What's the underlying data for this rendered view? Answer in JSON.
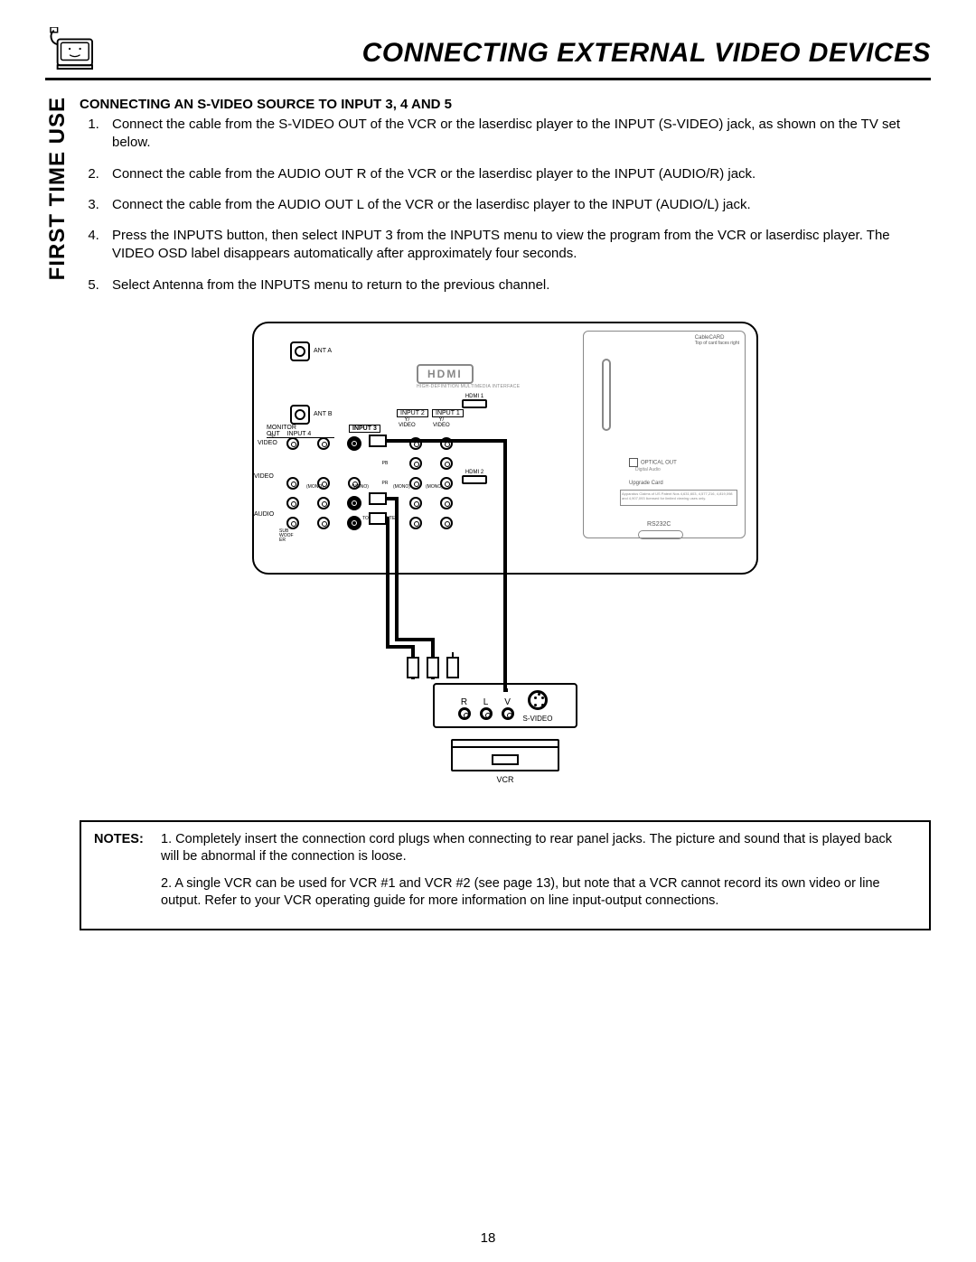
{
  "header": {
    "page_title": "CONNECTING EXTERNAL VIDEO DEVICES",
    "side_label": "FIRST TIME USE"
  },
  "section": {
    "heading": "CONNECTING AN S-VIDEO SOURCE TO INPUT 3, 4 AND 5",
    "steps": [
      "Connect the cable from the S-VIDEO OUT of the VCR or the laserdisc player to the INPUT (S-VIDEO) jack, as shown on the TV set below.",
      "Connect the cable from the AUDIO OUT R of the VCR or the laserdisc player to the INPUT (AUDIO/R) jack.",
      "Connect the cable from the AUDIO OUT L of the VCR or the laserdisc player to the INPUT (AUDIO/L) jack.",
      "Press the INPUTS button, then select INPUT 3 from the INPUTS menu to view the program from the VCR or laserdisc player. The VIDEO OSD label disappears automatically after approximately four seconds.",
      "Select Antenna from the INPUTS menu to return to the previous channel."
    ]
  },
  "diagram": {
    "ant_a": "ANT A",
    "ant_b": "ANT B",
    "hdmi_logo": "HDMI",
    "hdmi_sub": "HIGH-DEFINITION MULTIMEDIA INTERFACE",
    "hdmi1": "HDMI 1",
    "hdmi2": "HDMI 2",
    "monitor_out": "MONITOR OUT",
    "input4": "INPUT 4",
    "input3": "INPUT 3",
    "input2": "INPUT 2",
    "input1": "INPUT 1",
    "yvideo": "Y/\nVIDEO",
    "pb": "PB",
    "pr": "PR",
    "svideo": "S-VIDEO",
    "video": "VIDEO",
    "audio": "AUDIO",
    "mono": "(MONO)",
    "lr": "L\nR",
    "center": "TO AVC CENTER",
    "sub": "SUB\nWOOF\nER",
    "optical": "OPTICAL OUT",
    "optical_sub": "Digital Audio",
    "upgrade": "Upgrade Card",
    "rs232": "RS232C",
    "cablecard_top": "CableCARD\nTop of card faces right",
    "vcr_r": "R",
    "vcr_l": "L",
    "vcr_v": "V",
    "vcr_sv": "S-VIDEO",
    "vcr_caption": "VCR"
  },
  "notes": {
    "label": "NOTES:",
    "items": [
      "1.   Completely insert the connection cord plugs when connecting to rear panel jacks.  The picture and sound that is played back will be abnormal if the connection is loose.",
      "2.   A single VCR can be used for VCR #1 and VCR #2 (see page 13), but note that a VCR cannot record its own video or line output.  Refer to your VCR operating guide for more information on line input-output connections."
    ]
  },
  "page_number": "18"
}
